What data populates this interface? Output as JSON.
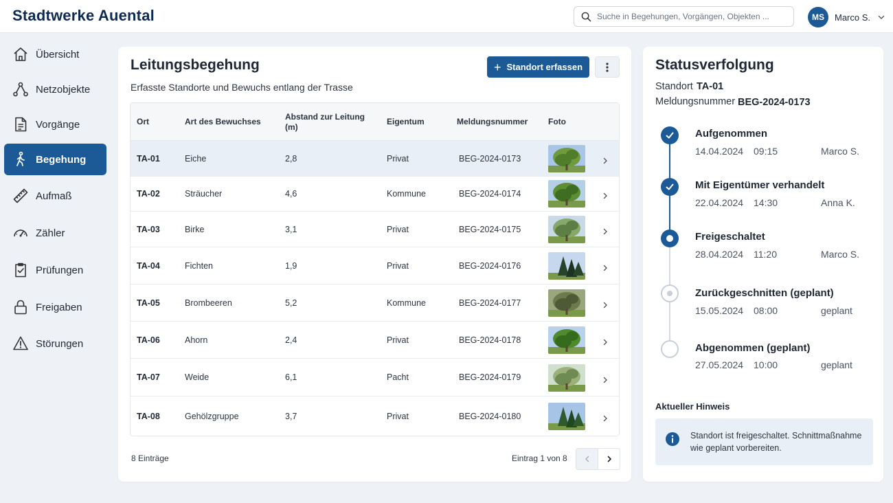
{
  "app": {
    "name": "Stadtwerke Auental"
  },
  "search": {
    "placeholder": "Suche in Begehungen, Vorgängen, Objekten ..."
  },
  "user": {
    "initials": "MS",
    "name": "Marco S."
  },
  "sidebar": {
    "items": [
      {
        "label": "Übersicht",
        "icon": "home-icon",
        "active": false
      },
      {
        "label": "Netzobjekte",
        "icon": "network-icon",
        "active": false
      },
      {
        "label": "Vorgänge",
        "icon": "document-icon",
        "active": false
      },
      {
        "label": "Begehung",
        "icon": "walking-person-icon",
        "active": true
      },
      {
        "label": "Aufmaß",
        "icon": "ruler-icon",
        "active": false
      },
      {
        "label": "Zähler",
        "icon": "gauge-icon",
        "active": false
      },
      {
        "label": "Prüfungen",
        "icon": "checklist-icon",
        "active": false
      },
      {
        "label": "Freigaben",
        "icon": "lock-icon",
        "active": false
      },
      {
        "label": "Störungen",
        "icon": "warning-icon",
        "active": false
      }
    ]
  },
  "main": {
    "title": "Leitungsbegehung",
    "subtitle": "Erfasste Standorte und Bewuchs entlang der Trasse",
    "add_button": "Standort erfassen",
    "columns": [
      "Ort",
      "Art des Bewuchses",
      "Abstand zur Leitung (m)",
      "Eigentum",
      "Meldungsnummer",
      "Foto"
    ],
    "rows": [
      {
        "ort": "TA-01",
        "art": "Eiche",
        "abstand": "2,8",
        "eigentum": "Privat",
        "nummer": "BEG-2024-0173",
        "selected": true
      },
      {
        "ort": "TA-02",
        "art": "Sträucher",
        "abstand": "4,6",
        "eigentum": "Kommune",
        "nummer": "BEG-2024-0174",
        "selected": false
      },
      {
        "ort": "TA-03",
        "art": "Birke",
        "abstand": "3,1",
        "eigentum": "Privat",
        "nummer": "BEG-2024-0175",
        "selected": false
      },
      {
        "ort": "TA-04",
        "art": "Fichten",
        "abstand": "1,9",
        "eigentum": "Privat",
        "nummer": "BEG-2024-0176",
        "selected": false
      },
      {
        "ort": "TA-05",
        "art": "Brombeeren",
        "abstand": "5,2",
        "eigentum": "Kommune",
        "nummer": "BEG-2024-0177",
        "selected": false
      },
      {
        "ort": "TA-06",
        "art": "Ahorn",
        "abstand": "2,4",
        "eigentum": "Privat",
        "nummer": "BEG-2024-0178",
        "selected": false
      },
      {
        "ort": "TA-07",
        "art": "Weide",
        "abstand": "6,1",
        "eigentum": "Pacht",
        "nummer": "BEG-2024-0179",
        "selected": false
      },
      {
        "ort": "TA-08",
        "art": "Gehölzgruppe",
        "abstand": "3,7",
        "eigentum": "Privat",
        "nummer": "BEG-2024-0180",
        "selected": false
      }
    ],
    "count": "8 Einträge",
    "range": "Eintrag 1 von 8"
  },
  "status": {
    "title": "Statusverfolgung",
    "standort_label": "Standort",
    "standort_value": "TA-01",
    "meldung_label": "Meldungsnummer",
    "meldung_value": "BEG-2024-0173",
    "steps": [
      {
        "title": "Aufgenommen",
        "date": "14.04.2024",
        "time": "09:15",
        "who": "Marco S.",
        "state": "done"
      },
      {
        "title": "Mit Eigentümer verhandelt",
        "date": "22.04.2024",
        "time": "14:30",
        "who": "Anna K.",
        "state": "done"
      },
      {
        "title": "Freigeschaltet",
        "date": "28.04.2024",
        "time": "11:20",
        "who": "Marco S.",
        "state": "current"
      },
      {
        "title": "Zurückgeschnitten (geplant)",
        "date": "15.05.2024",
        "time": "08:00",
        "who": "geplant",
        "state": "planned"
      },
      {
        "title": "Abgenommen (geplant)",
        "date": "27.05.2024",
        "time": "10:00",
        "who": "geplant",
        "state": "empty"
      }
    ],
    "hint_title": "Aktueller Hinweis",
    "hint_text": "Standort ist freigeschaltet. Schnittmaßnahme wie geplant vorbereiten."
  },
  "colors": {
    "brand": "#1b5a96",
    "logo": "#0e2a4f",
    "selected_row": "#e8eff7"
  }
}
